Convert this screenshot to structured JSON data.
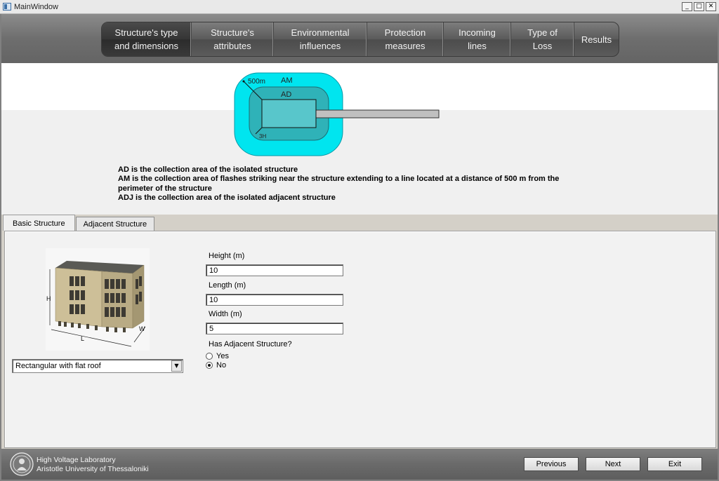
{
  "window": {
    "title": "MainWindow",
    "controls": [
      "_",
      "□",
      "✕"
    ]
  },
  "nav": {
    "items": [
      {
        "label": "Structure's type\nand dimensions",
        "active": true
      },
      {
        "label": "Structure's\nattributes",
        "active": false
      },
      {
        "label": "Environmental\ninfluences",
        "active": false
      },
      {
        "label": "Protection\nmeasures",
        "active": false
      },
      {
        "label": "Incoming\nlines",
        "active": false
      },
      {
        "label": "Type of\nLoss",
        "active": false
      },
      {
        "label": "Results",
        "active": false
      }
    ]
  },
  "diagram": {
    "am_label": "AM",
    "ad_label": "AD",
    "distance_label": "500m",
    "height_label": "3H",
    "colors": {
      "am_fill": "#00e5ef",
      "ad_fill": "#2fb2b8",
      "structure_fill": "#58c6cb",
      "line_fill": "#c0c0c0"
    }
  },
  "description": {
    "line1": "AD is the collection area of the isolated structure",
    "line2": "AM is the collection area of flashes striking near the structure extending to a line located at a distance of 500 m from the perimeter of the structure",
    "line3": "ADJ is the collection area of the isolated adjacent structure"
  },
  "tabs": {
    "basic": "Basic Structure",
    "adjacent": "Adjacent Structure"
  },
  "basic": {
    "building_labels": {
      "h": "H",
      "l": "L",
      "w": "W"
    },
    "shape_selected": "Rectangular with flat roof",
    "height": {
      "label": "Height (m)",
      "value": "10"
    },
    "length": {
      "label": "Length (m)",
      "value": "10"
    },
    "width": {
      "label": "Width (m)",
      "value": "5"
    },
    "adjacent_question": "Has Adjacent Structure?",
    "yes_label": "Yes",
    "no_label": "No",
    "adjacent_selected": "No"
  },
  "footer": {
    "lab_line1": "High Voltage Laboratory",
    "lab_line2": "Aristotle University of Thessaloniki",
    "previous": "Previous",
    "next": "Next",
    "exit": "Exit"
  }
}
